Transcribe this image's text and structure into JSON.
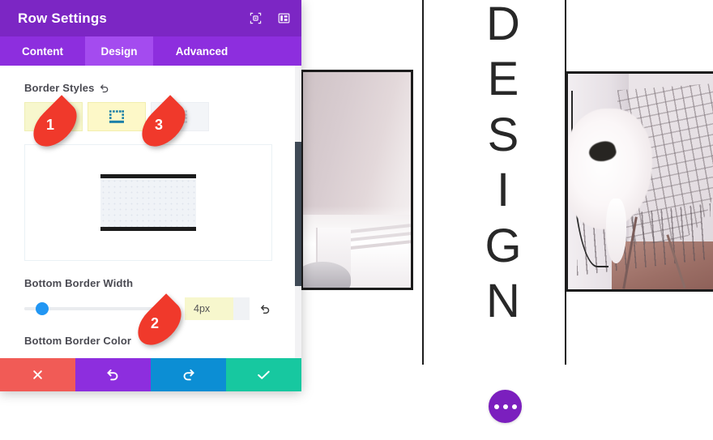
{
  "modal": {
    "title": "Row Settings",
    "header_icons": [
      {
        "name": "focus-target-icon",
        "label": "focus"
      },
      {
        "name": "panel-layout-icon",
        "label": "layout"
      }
    ],
    "tabs": [
      {
        "id": "content",
        "label": "Content",
        "active": false
      },
      {
        "id": "design",
        "label": "Design",
        "active": true
      },
      {
        "id": "advanced",
        "label": "Advanced",
        "active": false
      }
    ],
    "sections": {
      "border_styles": {
        "label": "Border Styles",
        "reset_icon": "undo-arrow-icon",
        "options": [
          {
            "id": "top-border",
            "icon": "border-top-icon",
            "state": "highlighted"
          },
          {
            "id": "bottom-border",
            "icon": "border-bottom-icon",
            "state": "highlighted-selected"
          },
          {
            "id": "left-border",
            "icon": "border-left-icon",
            "state": "disabled"
          }
        ]
      },
      "preview": {
        "label": "border-preview",
        "top_border": true,
        "bottom_border": true
      },
      "bottom_border_width": {
        "label": "Bottom Border Width",
        "value": "4px",
        "slider_percent": 8,
        "reset_icon": "undo-arrow-icon"
      },
      "bottom_border_color": {
        "label": "Bottom Border Color"
      }
    },
    "footer_buttons": [
      {
        "id": "cancel",
        "icon": "close-x-icon",
        "color": "#f15b56"
      },
      {
        "id": "undo",
        "icon": "undo-arrow-icon",
        "color": "#8d2ede"
      },
      {
        "id": "redo",
        "icon": "redo-arrow-icon",
        "color": "#0c8ed4"
      },
      {
        "id": "save",
        "icon": "checkmark-icon",
        "color": "#17c8a0"
      }
    ]
  },
  "markers": [
    {
      "id": "marker-1",
      "number": "1"
    },
    {
      "id": "marker-3",
      "number": "3"
    },
    {
      "id": "marker-2",
      "number": "2"
    }
  ],
  "page": {
    "headline_letters": [
      "D",
      "E",
      "S",
      "I",
      "G",
      "N"
    ],
    "left_image_alt": "pink-wall-interior-photo",
    "right_image_alt": "white-fur-on-wire-chair-photo",
    "fab": {
      "name": "more-options-fab",
      "dots": 3
    }
  },
  "colors": {
    "modal_header": "#7c26c4",
    "tab_bar": "#8d2ede",
    "tab_active": "#a44bef",
    "highlight_yellow": "#f7f7cd",
    "highlight_yellow_strong": "#fdf8c8",
    "marker_red": "#f0392b",
    "slider_blue": "#2196f3",
    "fab_purple": "#7b1fbe"
  }
}
